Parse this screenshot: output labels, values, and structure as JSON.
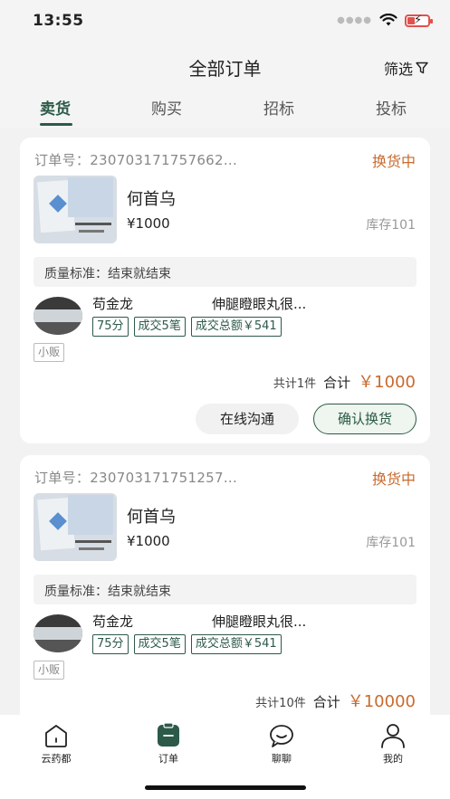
{
  "status_bar": {
    "time": "13:55"
  },
  "header": {
    "title": "全部订单",
    "filter_label": "筛选"
  },
  "tabs": [
    {
      "label": "卖货",
      "active": true
    },
    {
      "label": "购买",
      "active": false
    },
    {
      "label": "招标",
      "active": false
    },
    {
      "label": "投标",
      "active": false
    }
  ],
  "orders": [
    {
      "order_no": "订单号：230703171757662...",
      "status": "换货中",
      "product_name": "何首乌",
      "price": "¥1000",
      "stock": "库存101",
      "quality": "质量标准：结束就结束",
      "seller_name": "苟金龙",
      "product_desc": "伸腿瞪眼丸很...",
      "tags": [
        "75分",
        "成交5笔",
        "成交总额￥541"
      ],
      "tier": "小贩",
      "total_count": "共计1件",
      "total_label": "合计",
      "total_amount": "￥1000",
      "btn_chat": "在线沟通",
      "btn_confirm": "确认换货"
    },
    {
      "order_no": "订单号：230703171751257...",
      "status": "换货中",
      "product_name": "何首乌",
      "price": "¥1000",
      "stock": "库存101",
      "quality": "质量标准：结束就结束",
      "seller_name": "苟金龙",
      "product_desc": "伸腿瞪眼丸很...",
      "tags": [
        "75分",
        "成交5笔",
        "成交总额￥541"
      ],
      "tier": "小贩",
      "total_count": "共计10件",
      "total_label": "合计",
      "total_amount": "￥10000"
    }
  ],
  "tab_bar": [
    {
      "label": "云药都",
      "icon": "home-icon",
      "active": false
    },
    {
      "label": "订单",
      "icon": "order-icon",
      "active": true
    },
    {
      "label": "聊聊",
      "icon": "chat-icon",
      "active": false
    },
    {
      "label": "我的",
      "icon": "profile-icon",
      "active": false
    }
  ],
  "colors": {
    "accent": "#2c5a48",
    "status": "#c96a2e",
    "background": "#f2f2f2"
  }
}
